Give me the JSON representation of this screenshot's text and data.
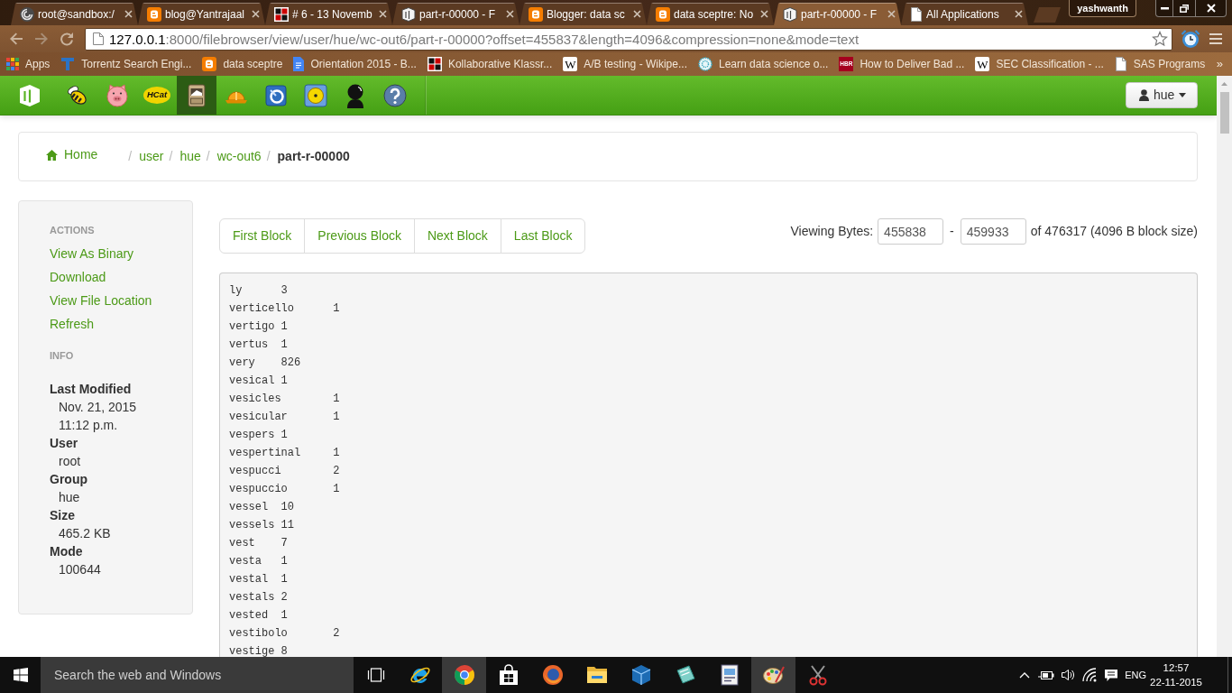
{
  "browser": {
    "tabs": [
      {
        "title": "root@sandbox:/",
        "selected": false
      },
      {
        "title": "blog@Yantrajaal",
        "selected": false
      },
      {
        "title": "# 6 - 13 Novemb",
        "selected": false
      },
      {
        "title": "part-r-00000 - F",
        "selected": false
      },
      {
        "title": "Blogger: data sc",
        "selected": false
      },
      {
        "title": "data sceptre: No",
        "selected": false
      },
      {
        "title": "part-r-00000 - F",
        "selected": true
      },
      {
        "title": "All Applications",
        "selected": false
      }
    ],
    "profile": "yashwanth",
    "url_host": "127.0.0.1",
    "url_rest": ":8000/filebrowser/view/user/hue/wc-out6/part-r-00000?offset=455837&length=4096&compression=none&mode=text",
    "bookmarks": [
      {
        "label": "Apps"
      },
      {
        "label": "Torrentz Search Engi..."
      },
      {
        "label": "data sceptre"
      },
      {
        "label": "Orientation 2015 - B..."
      },
      {
        "label": "Kollaborative Klassr..."
      },
      {
        "label": "A/B testing - Wikipe...",
        "icon_text": "W"
      },
      {
        "label": "Learn data science o..."
      },
      {
        "label": "How to Deliver Bad ...",
        "icon_text": "HBR"
      },
      {
        "label": "SEC Classification - ...",
        "icon_text": "W"
      },
      {
        "label": "SAS Programs"
      }
    ],
    "bookmarks_more": "»"
  },
  "hue": {
    "nav": [
      {
        "selected": false
      },
      {
        "selected": false
      },
      {
        "label": "HCat",
        "selected": false
      },
      {
        "selected": true
      },
      {
        "selected": false
      },
      {
        "selected": false
      },
      {
        "selected": false
      },
      {
        "selected": false
      },
      {
        "selected": false
      }
    ],
    "user": "hue",
    "breadcrumb": {
      "home": "Home",
      "path": [
        {
          "separator": "/",
          "label": "user",
          "current": false
        },
        {
          "separator": "/",
          "label": "hue",
          "current": false
        },
        {
          "separator": "/",
          "label": "wc-out6",
          "current": false
        },
        {
          "separator": "/",
          "label": "part-r-00000",
          "current": true
        }
      ]
    },
    "sidebar": {
      "actions": {
        "title": "ACTIONS",
        "links": [
          "View As Binary",
          "Download",
          "View File Location",
          "Refresh"
        ]
      },
      "info": {
        "title": "INFO",
        "fields": [
          {
            "label": "Last Modified",
            "values": [
              "Nov. 21, 2015",
              "11:12 p.m."
            ]
          },
          {
            "label": "User",
            "values": [
              "root"
            ]
          },
          {
            "label": "Group",
            "values": [
              "hue"
            ]
          },
          {
            "label": "Size",
            "values": [
              "465.2 KB"
            ]
          },
          {
            "label": "Mode",
            "values": [
              "100644"
            ]
          }
        ]
      }
    },
    "pager": [
      "First Block",
      "Previous Block",
      "Next Block",
      "Last Block"
    ],
    "viewing": {
      "label": "Viewing Bytes:",
      "from": "455838",
      "dash": "-",
      "to": "459933",
      "total": "of 476317 (4096 B block size)"
    },
    "file_lines": [
      "ly\t3",
      "verticello\t1",
      "vertigo\t1",
      "vertus\t1",
      "very\t826",
      "vesical\t1",
      "vesicles\t1",
      "vesicular\t1",
      "vespers\t1",
      "vespertinal\t1",
      "vespucci\t2",
      "vespuccio\t1",
      "vessel\t10",
      "vessels\t11",
      "vest\t7",
      "vesta\t1",
      "vestal\t1",
      "vestals\t2",
      "vested\t1",
      "vestibolo\t2",
      "vestige\t8"
    ]
  },
  "taskbar": {
    "search_placeholder": "Search the web and Windows",
    "apps": [
      {
        "highlighted": false
      },
      {
        "highlighted": true
      },
      {
        "highlighted": false
      },
      {
        "highlighted": false
      },
      {
        "highlighted": false
      },
      {
        "highlighted": false
      },
      {
        "highlighted": false
      },
      {
        "highlighted": false
      },
      {
        "highlighted": true
      },
      {
        "highlighted": false
      }
    ],
    "language": "ENG",
    "time": "12:57",
    "date": "22-11-2015"
  }
}
